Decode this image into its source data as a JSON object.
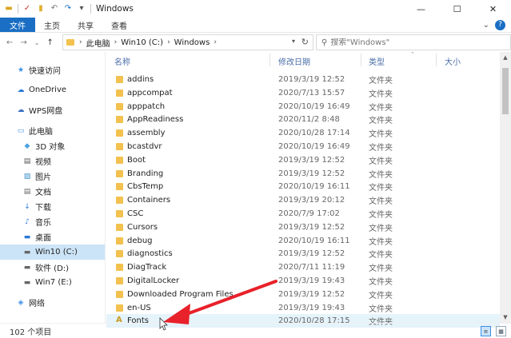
{
  "titlebar": {
    "title": "Windows",
    "quick_access_icons": [
      "folder-icon",
      "properties-icon",
      "new-folder-icon",
      "undo-icon",
      "redo-icon",
      "dropdown-icon"
    ],
    "minimize": "—",
    "maximize": "☐",
    "close": "✕"
  },
  "ribbon": {
    "tabs": [
      "文件",
      "主页",
      "共享",
      "查看"
    ],
    "expand_icon": "⌄",
    "help_icon": "?"
  },
  "address": {
    "back": "←",
    "forward": "→",
    "history": "⌄",
    "up": "↑",
    "crumbs": [
      "此电脑",
      "Win10 (C:)",
      "Windows"
    ],
    "separator": "›",
    "refresh": "↻"
  },
  "search": {
    "placeholder": "搜索\"Windows\""
  },
  "sidebar": {
    "items": [
      {
        "label": "快速访问",
        "icon": "star-icon",
        "glyph": "★",
        "color": "#3a8ee6"
      },
      {
        "label": "OneDrive",
        "icon": "cloud-icon",
        "glyph": "☁",
        "color": "#2b79d6"
      },
      {
        "label": "WPS网盘",
        "icon": "cloud-drive-icon",
        "glyph": "☁",
        "color": "#3a6fc0"
      },
      {
        "label": "此电脑",
        "icon": "computer-icon",
        "glyph": "▭",
        "color": "#4a90d9"
      },
      {
        "label": "3D 对象",
        "icon": "3d-objects-icon",
        "glyph": "◆",
        "color": "#4aa3df"
      },
      {
        "label": "视频",
        "icon": "video-icon",
        "glyph": "▤",
        "color": "#555"
      },
      {
        "label": "图片",
        "icon": "pictures-icon",
        "glyph": "▨",
        "color": "#3e8fc8"
      },
      {
        "label": "文档",
        "icon": "documents-icon",
        "glyph": "▤",
        "color": "#666"
      },
      {
        "label": "下载",
        "icon": "downloads-icon",
        "glyph": "↓",
        "color": "#2b79d6"
      },
      {
        "label": "音乐",
        "icon": "music-icon",
        "glyph": "♪",
        "color": "#2b79d6"
      },
      {
        "label": "桌面",
        "icon": "desktop-icon",
        "glyph": "▬",
        "color": "#2b79d6"
      },
      {
        "label": "Win10 (C:)",
        "icon": "drive-c-icon",
        "glyph": "▬",
        "color": "#666"
      },
      {
        "label": "软件 (D:)",
        "icon": "drive-d-icon",
        "glyph": "▬",
        "color": "#666"
      },
      {
        "label": "Win7 (E:)",
        "icon": "drive-e-icon",
        "glyph": "▬",
        "color": "#666"
      },
      {
        "label": "网络",
        "icon": "network-icon",
        "glyph": "◈",
        "color": "#3a8ee6"
      }
    ],
    "selected_index": 11
  },
  "columns": {
    "name": "名称",
    "modified": "修改日期",
    "type": "类型",
    "size": "大小"
  },
  "files": [
    {
      "name": "addins",
      "date": "2019/3/19 12:52",
      "type": "文件夹"
    },
    {
      "name": "appcompat",
      "date": "2020/7/13 15:57",
      "type": "文件夹"
    },
    {
      "name": "apppatch",
      "date": "2020/10/19 16:49",
      "type": "文件夹"
    },
    {
      "name": "AppReadiness",
      "date": "2020/11/2 8:48",
      "type": "文件夹"
    },
    {
      "name": "assembly",
      "date": "2020/10/28 17:14",
      "type": "文件夹"
    },
    {
      "name": "bcastdvr",
      "date": "2020/10/19 16:49",
      "type": "文件夹"
    },
    {
      "name": "Boot",
      "date": "2019/3/19 12:52",
      "type": "文件夹"
    },
    {
      "name": "Branding",
      "date": "2019/3/19 12:52",
      "type": "文件夹"
    },
    {
      "name": "CbsTemp",
      "date": "2020/10/19 16:11",
      "type": "文件夹"
    },
    {
      "name": "Containers",
      "date": "2019/3/19 20:12",
      "type": "文件夹"
    },
    {
      "name": "CSC",
      "date": "2020/7/9 17:02",
      "type": "文件夹"
    },
    {
      "name": "Cursors",
      "date": "2019/3/19 12:52",
      "type": "文件夹"
    },
    {
      "name": "debug",
      "date": "2020/10/19 16:11",
      "type": "文件夹"
    },
    {
      "name": "diagnostics",
      "date": "2019/3/19 12:52",
      "type": "文件夹"
    },
    {
      "name": "DiagTrack",
      "date": "2020/7/11 11:19",
      "type": "文件夹"
    },
    {
      "name": "DigitalLocker",
      "date": "2019/3/19 19:43",
      "type": "文件夹"
    },
    {
      "name": "Downloaded Program Files",
      "date": "2019/3/19 12:52",
      "type": "文件夹"
    },
    {
      "name": "en-US",
      "date": "2019/3/19 19:43",
      "type": "文件夹"
    },
    {
      "name": "Fonts",
      "date": "2020/10/28 17:15",
      "type": "文件夹"
    }
  ],
  "highlighted_file_index": 18,
  "status": {
    "count": "102 个项目"
  },
  "colors": {
    "accent": "#1a6fc4",
    "selection": "#cce4f7",
    "hover": "#e5f3fb",
    "folder": "#f2c14e",
    "annotation_arrow": "#e8212a"
  }
}
